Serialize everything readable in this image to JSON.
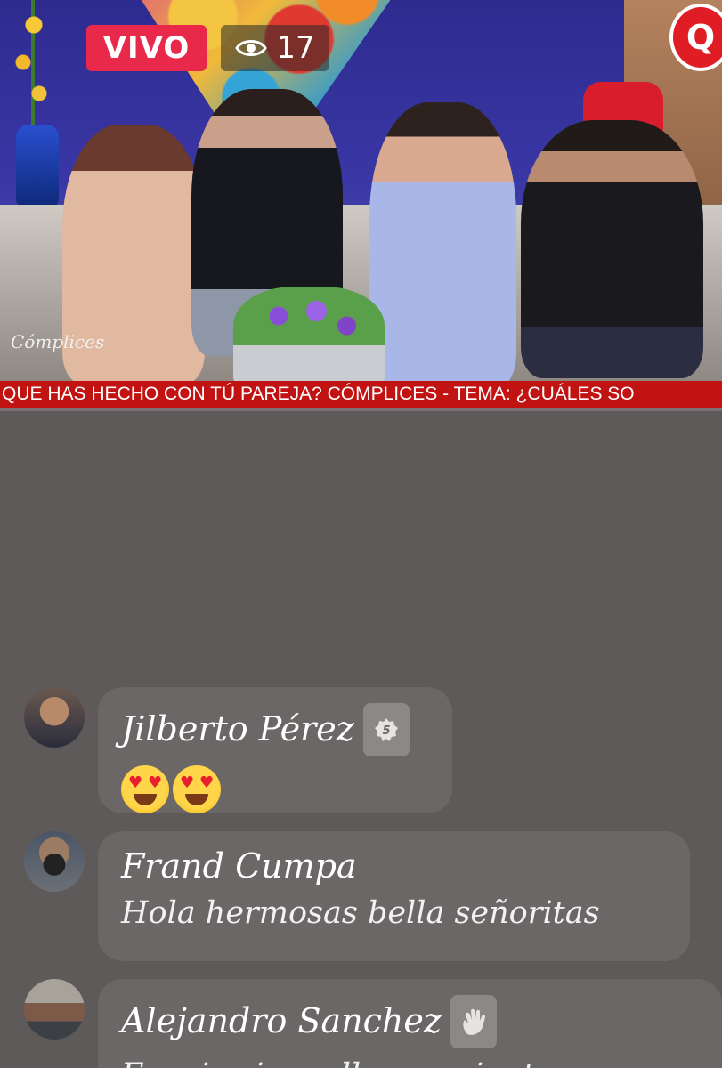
{
  "stream": {
    "live_label": "VIVO",
    "viewer_count": "17",
    "channel_logo_text": "Q",
    "show_watermark": "Cómplices",
    "ticker_text": "QUE HAS HECHO CON TÚ PAREJA?   CÓMPLICES - TEMA:  ¿CUÁLES SO"
  },
  "comments": [
    {
      "author": "Jilberto Pérez",
      "badge": "5",
      "badge_icon": "fan-level-badge-icon",
      "message": "😍😍",
      "message_kind": "emoji",
      "emoji_icon": "heart-eyes-emoji-icon",
      "emoji_count": 2
    },
    {
      "author": "Frand Cumpa",
      "message": "Hola hermosas bella señoritas"
    },
    {
      "author": "Alejandro Sanchez",
      "badge_icon": "waving-hand-icon",
      "message": "Es mi primo allo que siento"
    }
  ],
  "colors": {
    "live_red": "#e8294a",
    "ticker_red": "#c21313",
    "chat_background": "#5f5a5a",
    "bubble_background": "#6c6767"
  }
}
